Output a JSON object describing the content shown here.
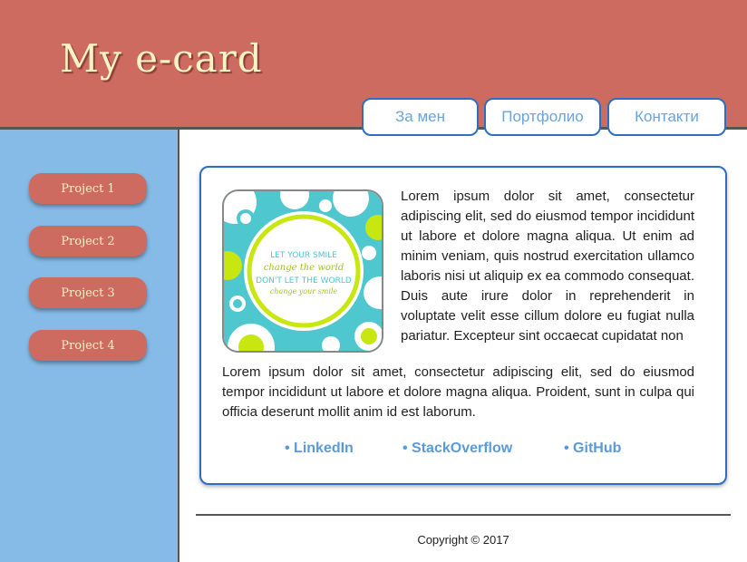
{
  "header": {
    "title": "My e-card"
  },
  "nav": {
    "tabs": [
      {
        "label": "За мен"
      },
      {
        "label": "Портфолио"
      },
      {
        "label": "Контакти"
      }
    ]
  },
  "sidebar": {
    "items": [
      {
        "label": "Project 1"
      },
      {
        "label": "Project 2"
      },
      {
        "label": "Project 3"
      },
      {
        "label": "Project 4"
      }
    ]
  },
  "card": {
    "image_text": {
      "line1": "LET YOUR SMILE",
      "line2": "change the world",
      "line3": "DON'T LET THE WORLD",
      "line4": "change your smile"
    },
    "paragraph_wrap": "Lorem ipsum dolor sit amet, consectetur adipiscing elit, sed do eiusmod tempor incididunt ut labore et dolore magna aliqua. Ut enim ad minim veniam, quis nostrud exercitation ullamco laboris nisi ut aliquip ex ea commodo consequat. Duis aute irure dolor in reprehenderit in voluptate velit esse cillum dolore eu fugiat nulla pariatur. Excepteur sint occaecat cupidatat non",
    "paragraph_full": "Lorem ipsum dolor sit amet, consectetur adipiscing elit, sed do eiusmod tempor incididunt ut labore et dolore magna aliqua. Proident, sunt in culpa qui officia deserunt mollit anim id est laborum."
  },
  "links": [
    {
      "label": "• LinkedIn"
    },
    {
      "label": "• StackOverflow"
    },
    {
      "label": "• GitHub"
    }
  ],
  "footer": {
    "copyright": "Copyright © 2017"
  },
  "colors": {
    "header_bg": "#cd6b61",
    "sidebar_bg": "#86bbe7",
    "accent_border": "#2c6fc2",
    "link": "#5a9ad8",
    "button_text": "#f7f3c4"
  }
}
